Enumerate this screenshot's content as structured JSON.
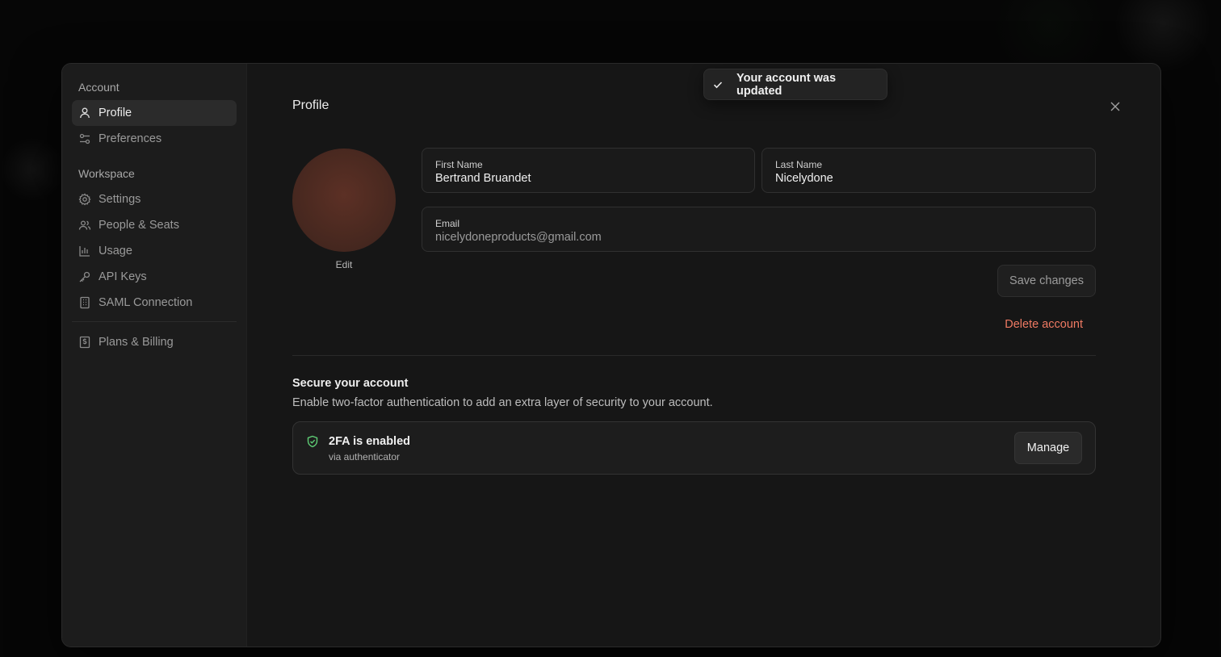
{
  "toast": {
    "message": "Your account was updated",
    "icon": "check-icon"
  },
  "sidebar": {
    "account_title": "Account",
    "account_items": [
      {
        "label": "Profile",
        "icon": "user-icon",
        "active": true
      },
      {
        "label": "Preferences",
        "icon": "sliders-icon",
        "active": false
      }
    ],
    "workspace_title": "Workspace",
    "workspace_items": [
      {
        "label": "Settings",
        "icon": "gear-icon"
      },
      {
        "label": "People & Seats",
        "icon": "users-icon"
      },
      {
        "label": "Usage",
        "icon": "bar-chart-icon"
      },
      {
        "label": "API Keys",
        "icon": "key-icon"
      },
      {
        "label": "SAML Connection",
        "icon": "building-icon"
      }
    ],
    "billing_item": {
      "label": "Plans & Billing",
      "icon": "receipt-icon"
    }
  },
  "profile": {
    "title": "Profile",
    "avatar_edit_label": "Edit",
    "avatar_color": "#4a2920",
    "first_name": {
      "label": "First Name",
      "value": "Bertrand Bruandet"
    },
    "last_name": {
      "label": "Last Name",
      "value": "Nicelydone"
    },
    "email": {
      "label": "Email",
      "value": "nicelydoneproducts@gmail.com"
    },
    "save_label": "Save changes",
    "delete_label": "Delete account",
    "delete_color": "#ef7a63"
  },
  "security": {
    "title": "Secure your account",
    "description": "Enable two-factor authentication to add an extra layer of security to your account.",
    "twofa_title": "2FA is enabled",
    "twofa_subtitle": "via authenticator",
    "manage_label": "Manage",
    "status_color": "#5fcf76"
  }
}
